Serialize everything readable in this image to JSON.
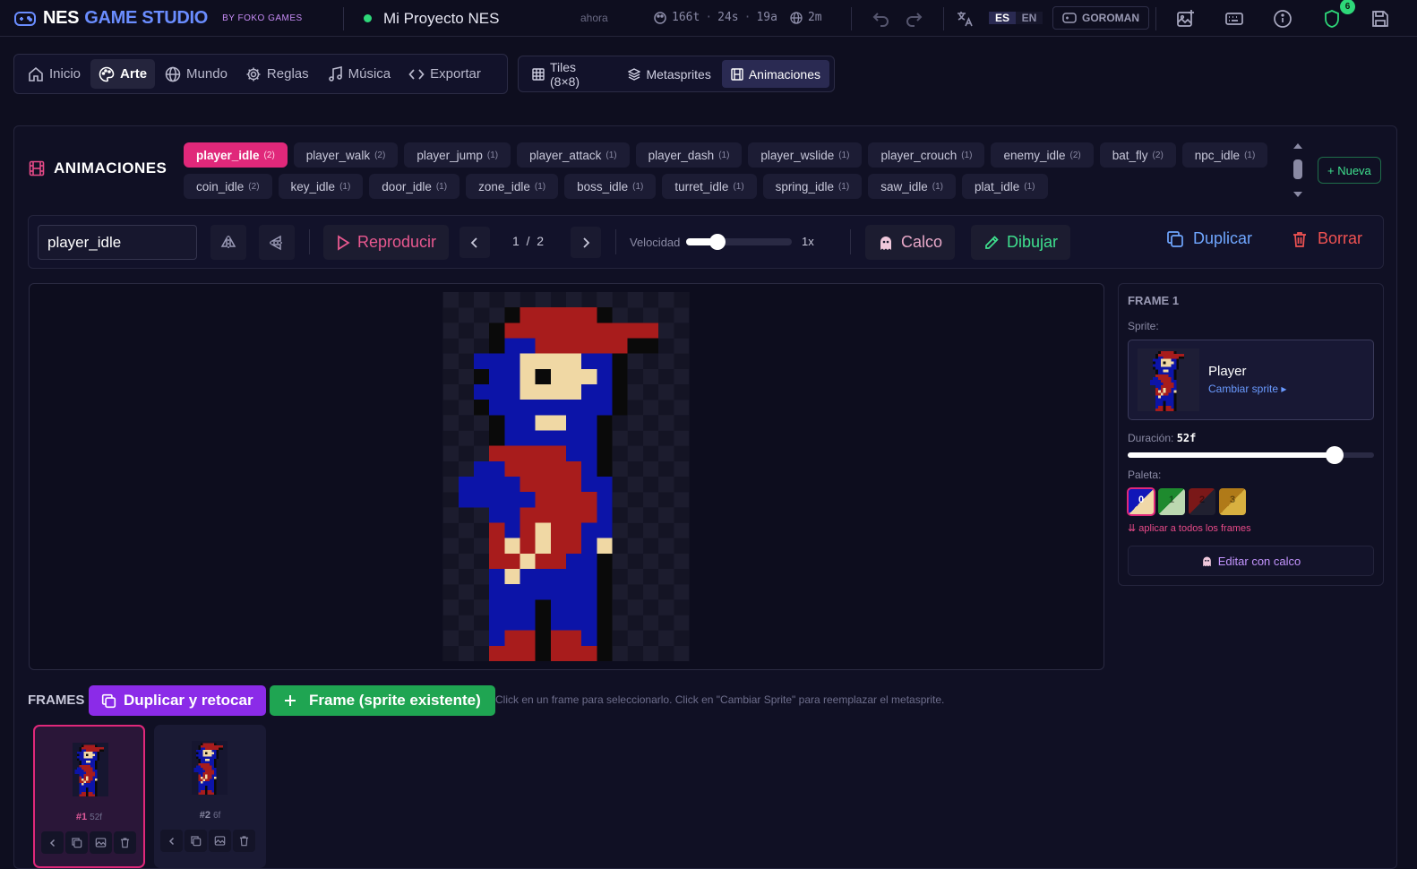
{
  "app": {
    "title_main": "NES",
    "title_accent": "GAME STUDIO",
    "by_line": "BY FOKO GAMES",
    "project_name": "Mi Proyecto NES",
    "saved_when": "ahora",
    "stats": [
      "166t",
      "24s",
      "19a",
      "2m"
    ],
    "lang_active": "ES",
    "lang_other": "EN",
    "user_label": "GOROMAN",
    "notif_count": "6"
  },
  "nav": {
    "tabs": [
      {
        "label": "Inicio",
        "icon": "home-icon"
      },
      {
        "label": "Arte",
        "icon": "palette-icon",
        "active": true
      },
      {
        "label": "Mundo",
        "icon": "globe-icon"
      },
      {
        "label": "Reglas",
        "icon": "gear-icon"
      },
      {
        "label": "Música",
        "icon": "music-note-icon"
      },
      {
        "label": "Exportar",
        "icon": "code-icon"
      }
    ],
    "subtabs": [
      {
        "label": "Tiles (8×8)",
        "icon": "grid-icon"
      },
      {
        "label": "Metasprites",
        "icon": "layers-icon"
      },
      {
        "label": "Animaciones",
        "icon": "film-icon",
        "active": true
      }
    ]
  },
  "animations": {
    "title": "ANIMACIONES",
    "new_label": "+ Nueva",
    "chips": [
      {
        "name": "player_idle",
        "count": "(2)",
        "active": true
      },
      {
        "name": "player_walk",
        "count": "(2)"
      },
      {
        "name": "player_jump",
        "count": "(1)"
      },
      {
        "name": "player_attack",
        "count": "(1)"
      },
      {
        "name": "player_dash",
        "count": "(1)"
      },
      {
        "name": "player_wslide",
        "count": "(1)"
      },
      {
        "name": "player_crouch",
        "count": "(1)"
      },
      {
        "name": "enemy_idle",
        "count": "(2)"
      },
      {
        "name": "bat_fly",
        "count": "(2)"
      },
      {
        "name": "npc_idle",
        "count": "(1)"
      },
      {
        "name": "coin_idle",
        "count": "(2)"
      },
      {
        "name": "key_idle",
        "count": "(1)"
      },
      {
        "name": "door_idle",
        "count": "(1)"
      },
      {
        "name": "zone_idle",
        "count": "(1)"
      },
      {
        "name": "boss_idle",
        "count": "(1)"
      },
      {
        "name": "turret_idle",
        "count": "(1)"
      },
      {
        "name": "spring_idle",
        "count": "(1)"
      },
      {
        "name": "saw_idle",
        "count": "(1)"
      },
      {
        "name": "plat_idle",
        "count": "(1)"
      }
    ]
  },
  "toolbar": {
    "anim_name": "player_idle",
    "play_label": "Reproducir",
    "frame_current": "1",
    "frame_sep": "/",
    "frame_total": "2",
    "speed_label": "Velocidad",
    "speed_value": "1x",
    "speed_fraction": 0.3,
    "onion_label": "Calco",
    "draw_label": "Dibujar",
    "duplicate_label": "Duplicar",
    "delete_label": "Borrar"
  },
  "frame_panel": {
    "title": "FRAME 1",
    "sprite_label": "Sprite:",
    "sprite_name": "Player",
    "change_sprite": "Cambiar sprite ▸",
    "duration_label": "Duración:",
    "duration_value": "52f",
    "duration_fraction": 0.84,
    "palette_label": "Paleta:",
    "palettes": [
      {
        "num": "0",
        "a": "#1016b8",
        "b": "#f0d8a8",
        "selected": true
      },
      {
        "num": "1",
        "a": "#1e8a2e",
        "b": "#bcd8b0"
      },
      {
        "num": "2",
        "a": "#7a1818",
        "b": "#202030"
      },
      {
        "num": "3",
        "a": "#b07a18",
        "b": "#d8b040"
      }
    ],
    "apply_all": "⇊ aplicar a todos los frames",
    "edit_onion": "Editar con calco"
  },
  "frames": {
    "label": "FRAMES",
    "dup_retouch": "Duplicar y retocar",
    "add_frame": "Frame (sprite existente)",
    "hint": "Click en un frame para seleccionarlo. Click en \"Cambiar Sprite\" para reemplazar el metasprite.",
    "items": [
      {
        "num": "#1",
        "dur": "52f",
        "active": true
      },
      {
        "num": "#2",
        "dur": "6f"
      }
    ]
  },
  "colors": {
    "accent_pink": "#e0287a",
    "nes_red": "#a81c1c",
    "nes_blue": "#0c14a8",
    "nes_skin": "#f0d8a4",
    "nes_black": "#0a0a0a"
  }
}
